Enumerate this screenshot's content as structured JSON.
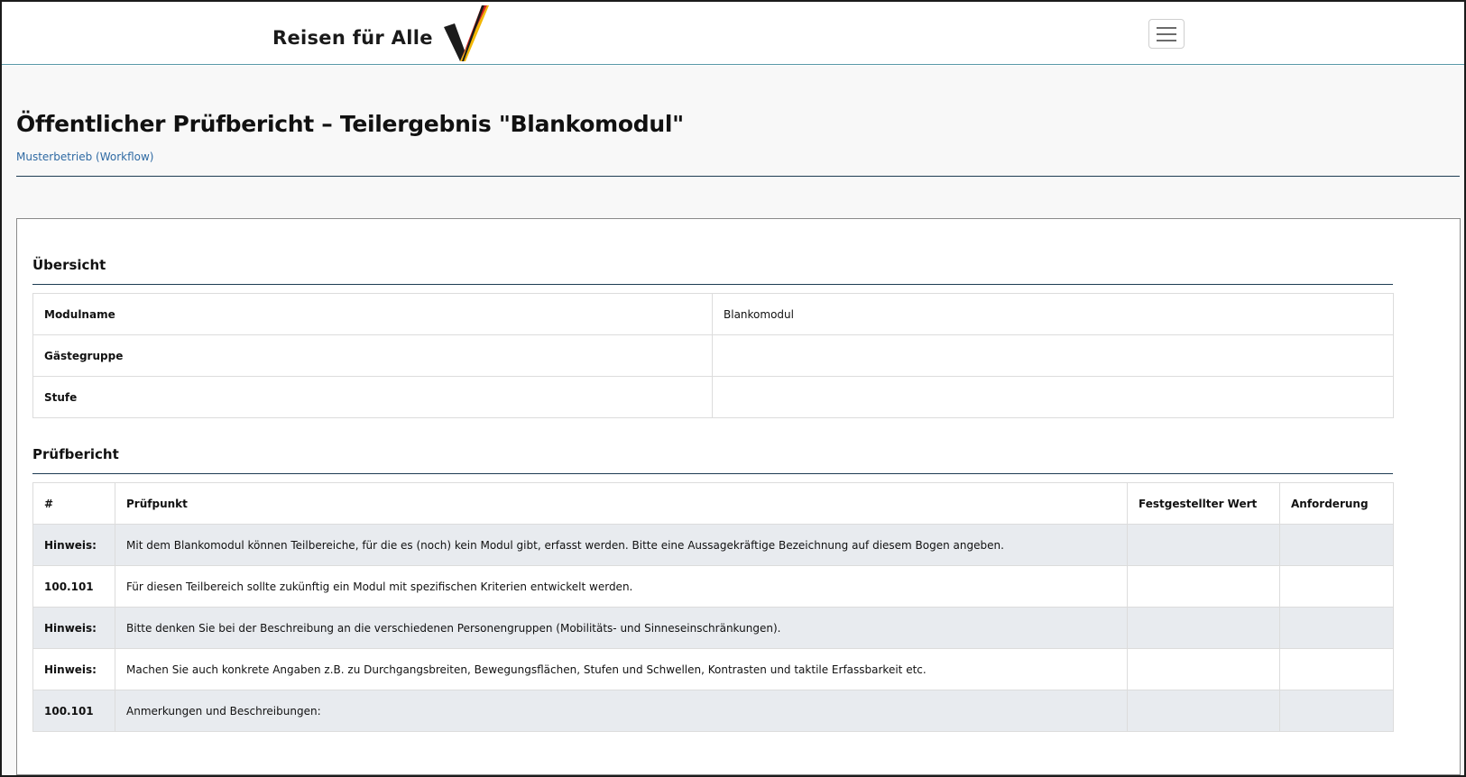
{
  "header": {
    "brand_text": "Reisen für Alle",
    "menu_icon": "hamburger-menu-icon"
  },
  "page": {
    "title": "Öffentlicher Prüfbericht – Teilergebnis \"Blankomodul\"",
    "subtitle": "Musterbetrieb (Workflow)"
  },
  "overview": {
    "heading": "Übersicht",
    "rows": [
      {
        "label": "Modulname",
        "value": "Blankomodul"
      },
      {
        "label": "Gästegruppe",
        "value": ""
      },
      {
        "label": "Stufe",
        "value": ""
      }
    ]
  },
  "report": {
    "heading": "Prüfbericht",
    "columns": [
      "#",
      "Prüfpunkt",
      "Festgestellter Wert",
      "Anforderung"
    ],
    "rows": [
      {
        "num": "Hinweis:",
        "text": "Mit dem Blankomodul können Teilbereiche, für die es (noch) kein Modul gibt, erfasst werden. Bitte eine Aussagekräftige Bezeichnung auf diesem Bogen angeben.",
        "value": "",
        "requirement": ""
      },
      {
        "num": "100.101",
        "text": "Für diesen Teilbereich sollte zukünftig ein Modul mit spezifischen Kriterien entwickelt werden.",
        "value": "",
        "requirement": ""
      },
      {
        "num": "Hinweis:",
        "text": "Bitte denken Sie bei der Beschreibung an die verschiedenen Personengruppen (Mobilitäts- und Sinneseinschränkungen).",
        "value": "",
        "requirement": ""
      },
      {
        "num": "Hinweis:",
        "text": "Machen Sie auch konkrete Angaben z.B. zu Durchgangsbreiten, Bewegungsflächen, Stufen und Schwellen, Kontrasten und taktile Erfassbarkeit etc.",
        "value": "",
        "requirement": ""
      },
      {
        "num": "100.101",
        "text": "Anmerkungen und Beschreibungen:",
        "value": "",
        "requirement": ""
      }
    ]
  },
  "colors": {
    "accent_link": "#2f6aa3",
    "rule": "#1d3c53",
    "row_shade": "#e8ebef",
    "logo_dark": "#1b1b1b",
    "logo_red": "#d6231b",
    "logo_gold": "#f2b705"
  }
}
